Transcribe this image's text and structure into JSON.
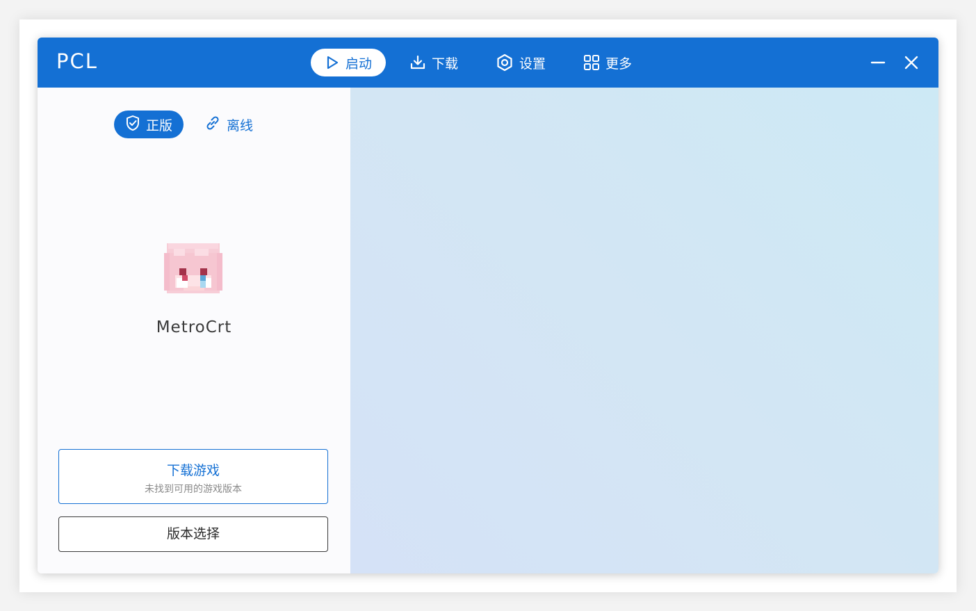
{
  "app": {
    "title": "PCL"
  },
  "nav": {
    "items": [
      {
        "label": "启动",
        "icon": "play-icon",
        "active": true
      },
      {
        "label": "下载",
        "icon": "download-icon",
        "active": false
      },
      {
        "label": "设置",
        "icon": "settings-icon",
        "active": false
      },
      {
        "label": "更多",
        "icon": "grid-icon",
        "active": false
      }
    ]
  },
  "window_controls": {
    "minimize_icon": "minimize-icon",
    "close_icon": "close-icon"
  },
  "account": {
    "modes": [
      {
        "label": "正版",
        "icon": "shield-check-icon",
        "active": true
      },
      {
        "label": "离线",
        "icon": "link-icon",
        "active": false
      }
    ],
    "username": "MetroCrt",
    "avatar_icon": "pixel-skin-head-icon"
  },
  "actions": {
    "download_game": {
      "label": "下载游戏",
      "sublabel": "未找到可用的游戏版本"
    },
    "version_select": {
      "label": "版本选择"
    }
  },
  "colors": {
    "accent": "#1470d4",
    "titlebar": "#1470d4",
    "panel_bg": "#fbfbfd",
    "content_gradient_start": "#cde9f5",
    "content_gradient_end": "#d5e2f7"
  }
}
